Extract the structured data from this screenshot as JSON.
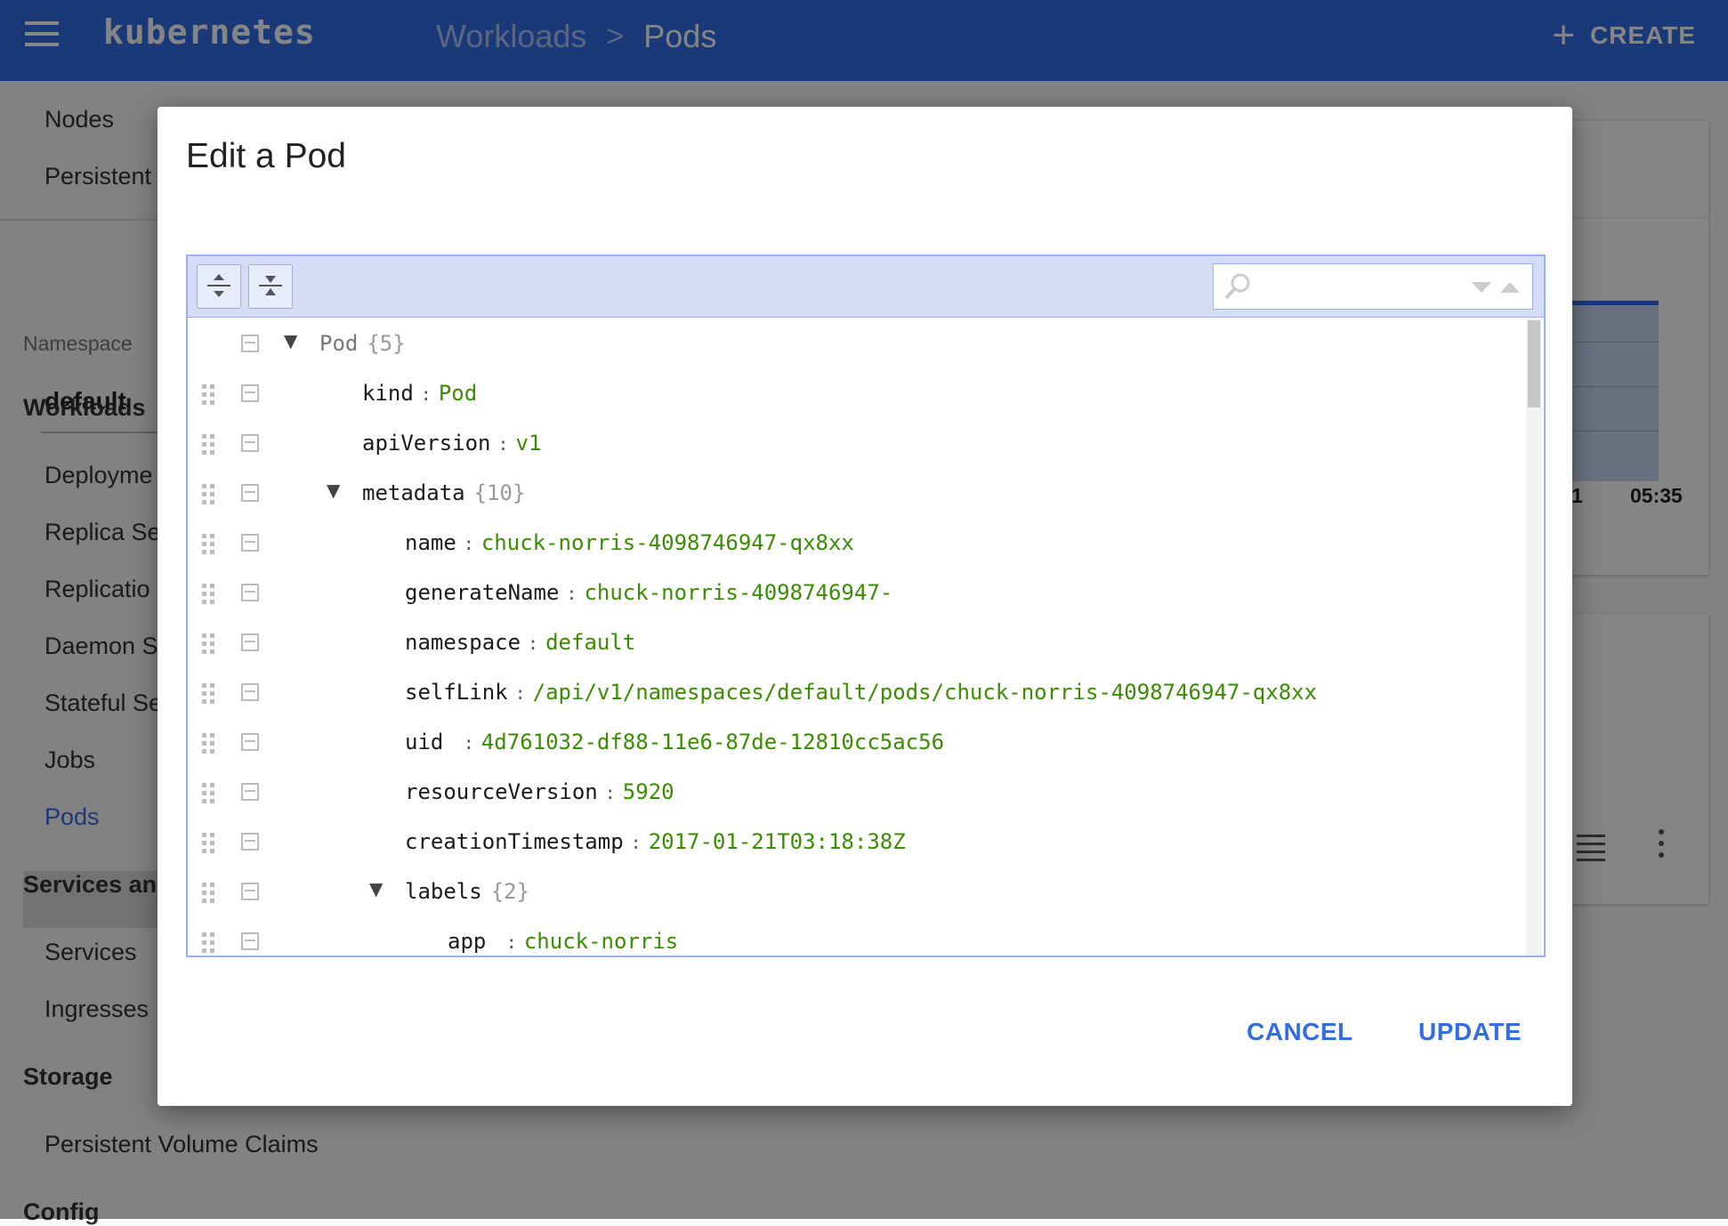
{
  "app": {
    "brand": "kubernetes",
    "breadcrumb": [
      "Workloads",
      "Pods"
    ],
    "breadcrumb_sep": ">",
    "create_label": "CREATE",
    "create_icon": "+"
  },
  "sidebar": {
    "top_items": [
      "Nodes",
      "Persistent"
    ],
    "namespace_label": "Namespace",
    "namespace_value": "default",
    "workloads_head": "Workloads",
    "workloads_items": [
      "Deployme",
      "Replica Se",
      "Replicatio",
      "Daemon S",
      "Stateful Se",
      "Jobs",
      "Pods"
    ],
    "services_head": "Services an",
    "services_items": [
      "Services",
      "Ingresses"
    ],
    "storage_head": "Storage",
    "storage_items": [
      "Persistent Volume Claims"
    ],
    "config_head": "Config"
  },
  "background": {
    "time_left": "1",
    "time_right": "05:35"
  },
  "dialog": {
    "title": "Edit a Pod",
    "cancel_label": "CANCEL",
    "update_label": "UPDATE",
    "tree": [
      {
        "key": "Pod",
        "count": "{5}",
        "toggle": "▼",
        "root": true
      },
      {
        "key": "kind",
        "value": "Pod"
      },
      {
        "key": "apiVersion",
        "value": "v1"
      },
      {
        "key": "metadata",
        "count": "{10}",
        "toggle": "▼"
      },
      {
        "key": "name",
        "value": "chuck-norris-4098746947-qx8xx"
      },
      {
        "key": "generateName",
        "value": "chuck-norris-4098746947-"
      },
      {
        "key": "namespace",
        "value": "default"
      },
      {
        "key": "selfLink",
        "value": "/api/v1/namespaces/default/pods/chuck-norris-4098746947-qx8xx"
      },
      {
        "key": "uid ",
        "value": "4d761032-df88-11e6-87de-12810cc5ac56"
      },
      {
        "key": "resourceVersion",
        "value": "5920"
      },
      {
        "key": "creationTimestamp",
        "value": "2017-01-21T03:18:38Z"
      },
      {
        "key": "labels",
        "count": "{2}",
        "toggle": "▼"
      },
      {
        "key": "app ",
        "value": "chuck-norris"
      }
    ],
    "colon": ":"
  }
}
